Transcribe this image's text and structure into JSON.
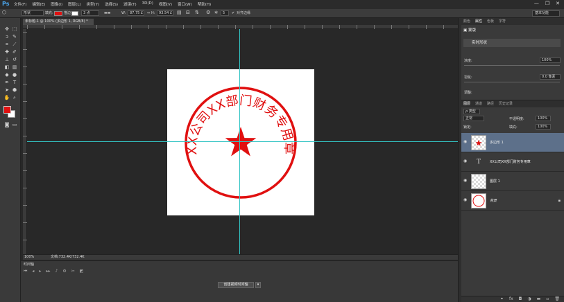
{
  "app": {
    "logo": "Ps"
  },
  "menu": [
    "文件(F)",
    "编辑(E)",
    "图像(I)",
    "图层(L)",
    "类型(Y)",
    "选择(S)",
    "滤镜(T)",
    "3D(D)",
    "视图(V)",
    "窗口(W)",
    "帮助(H)"
  ],
  "window_controls": {
    "minimize": "—",
    "restore": "❐",
    "close": "✕"
  },
  "options_bar": {
    "shape_mode": "形状",
    "fill_label": "填充:",
    "stroke_label": "描边:",
    "stroke_width": "3 点",
    "w_label": "W:",
    "w_value": "87.75 £",
    "h_label": "H:",
    "h_value": "93.54 £",
    "sides_value": "5",
    "align_edges": "对齐边缘",
    "workspace": "基本功能",
    "colors": {
      "fill": "#e01010",
      "stroke": "#ffffff"
    }
  },
  "tools": [
    "move-tool",
    "marquee-tool",
    "lasso-tool",
    "quick-select-tool",
    "crop-tool",
    "eyedropper-tool",
    "healing-tool",
    "brush-tool",
    "stamp-tool",
    "history-brush-tool",
    "eraser-tool",
    "gradient-tool",
    "blur-tool",
    "dodge-tool",
    "pen-tool",
    "type-tool",
    "path-select-tool",
    "shape-tool",
    "hand-tool",
    "zoom-tool"
  ],
  "document": {
    "tab_title": "未标题-1 @ 100% (多边形 1, RGB/8) *",
    "stamp_text": "XX公司XX部门财务专用章",
    "stamp_color": "#e01010"
  },
  "status": {
    "zoom": "100%",
    "doc_size": "文档:732.4K/732.4K"
  },
  "timeline": {
    "tab": "时间轴",
    "create_button": "创建视频时间轴"
  },
  "properties": {
    "tabs": [
      "颜色",
      "属性",
      "色板",
      "字符"
    ],
    "active_tab": "属性",
    "header": "蒙版",
    "live_shape": "实时形状",
    "density_label": "浓度:",
    "density_value": "100%",
    "feather_label": "羽化:",
    "feather_value": "0.0 像素",
    "adjust_label": "调整:"
  },
  "layers_panel": {
    "tabs": [
      "图层",
      "通道",
      "路径",
      "历史记录"
    ],
    "active_tab": "图层",
    "filter_kind": "ρ 类型",
    "blend_mode": "正常",
    "opacity_label": "不透明度:",
    "opacity_value": "100%",
    "lock_label": "锁定:",
    "fill_label": "填充:",
    "fill_value": "100%",
    "layers": [
      {
        "name": "多边形 1",
        "type": "shape",
        "selected": true
      },
      {
        "name": "XX公司XX部门财务专用章",
        "type": "text",
        "selected": false
      },
      {
        "name": "图层 1",
        "type": "raster",
        "selected": false
      },
      {
        "name": "背景",
        "type": "background",
        "selected": false,
        "locked": true
      }
    ],
    "footer_icons": [
      "link-icon",
      "fx-icon",
      "mask-icon",
      "adjustment-icon",
      "folder-icon",
      "new-layer-icon",
      "trash-icon"
    ]
  }
}
